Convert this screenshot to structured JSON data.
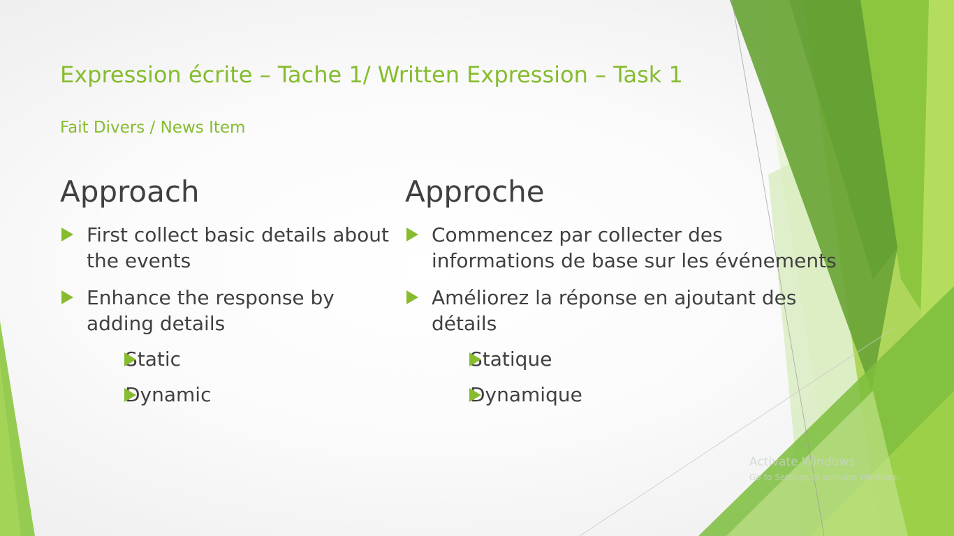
{
  "slide": {
    "title": "Expression écrite – Tache 1/ Written Expression – Task 1",
    "subtitle": "Fait Divers / News Item"
  },
  "left_column": {
    "heading": "Approach",
    "bullets": [
      "First collect basic details about the events",
      "Enhance the response by adding details"
    ],
    "sub_bullets": [
      "Static",
      "Dynamic"
    ]
  },
  "right_column": {
    "heading": "Approche",
    "bullets": [
      "Commencez par collecter des informations de base sur les événements",
      "Améliorez la réponse en ajoutant des détails"
    ],
    "sub_bullets": [
      "Statique",
      "Dynamique"
    ]
  },
  "watermark": {
    "title": "Activate Windows",
    "subtitle": "Go to Settings to activate Windows."
  },
  "theme": {
    "accent": "#86bc2e",
    "dark_green": "#5d9a2a",
    "text": "#404040"
  },
  "icons": [
    "triangle-bullet-icon"
  ]
}
